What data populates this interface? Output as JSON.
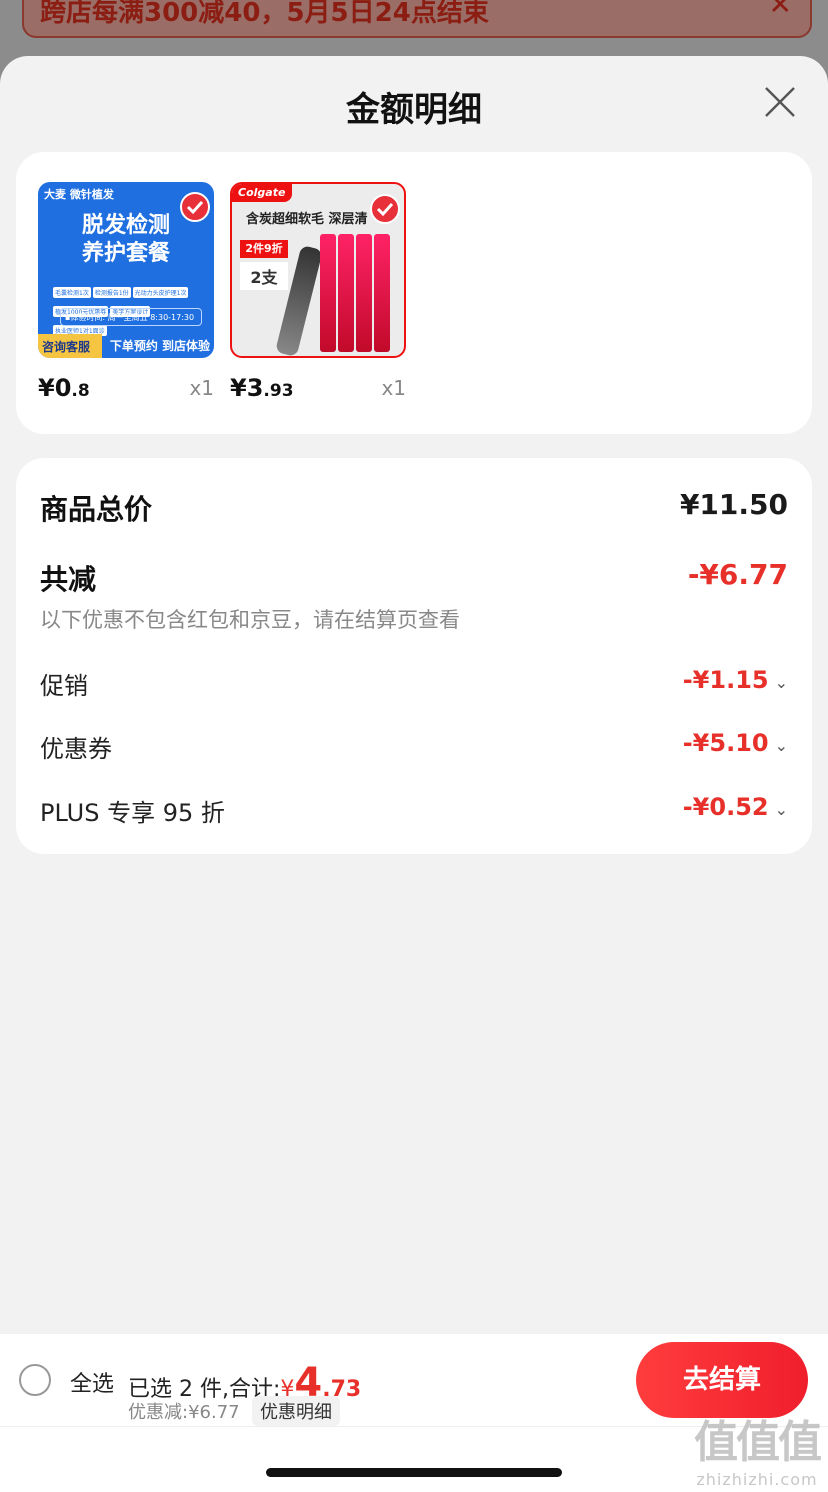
{
  "banner": {
    "text": "跨店每满300减40，5月5日24点结束"
  },
  "sheet": {
    "title": "金额明细"
  },
  "products": [
    {
      "image_text": {
        "top": "大麦 微针植发",
        "main": "脱发检测\n养护套餐",
        "chips": [
          "毛囊检测1次",
          "检测报告1份",
          "光动力头皮护理1次",
          "植发1000元优惠券",
          "美学方案设计",
          "执业医师1对1面诊"
        ],
        "time": "▪体验时间: 周一至周五 8:30-17:30",
        "bottom_left": "咨询客服",
        "bottom_right": "下单预约 到店体验"
      },
      "price_int": "¥0",
      "price_dec": ".8",
      "qty": "x1",
      "selected": true
    },
    {
      "image_text": {
        "brand": "Colgate",
        "headline": "含炭超细软毛 深层清",
        "deal": "2件9折",
        "deal_sub": "2支"
      },
      "price_int": "¥3",
      "price_dec": ".93",
      "qty": "x1",
      "selected": true
    }
  ],
  "summary": {
    "total_label": "商品总价",
    "total_value": "¥11.50",
    "reduce_label": "共减",
    "reduce_value": "-¥6.77",
    "note": "以下优惠不包含红包和京豆，请在结算页查看",
    "items": [
      {
        "label": "促销",
        "value": "-¥1.15"
      },
      {
        "label": "优惠券",
        "value": "-¥5.10"
      },
      {
        "label": "PLUS 专享 95 折",
        "value": "-¥0.52"
      }
    ]
  },
  "bottom": {
    "select_all": "全选",
    "selected_prefix": "已选 2 件,合计:",
    "currency": "¥",
    "total_int": "4",
    "total_dec": ".73",
    "discount": "优惠减:¥6.77",
    "detail_tag": "优惠明细",
    "checkout": "去结算"
  },
  "watermark": {
    "main": "值值值",
    "sub": "zhizhizhi.com"
  },
  "colors": {
    "accent": "#e8302a",
    "checkout": "#f01e2c"
  }
}
